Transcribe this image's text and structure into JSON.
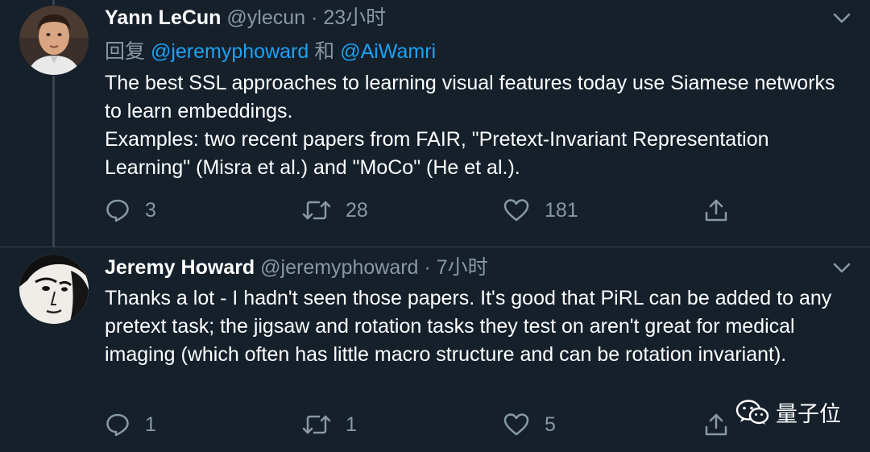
{
  "tweets": [
    {
      "display_name": "Yann LeCun",
      "handle": "@ylecun",
      "separator": "·",
      "time": "23小时",
      "reply_prefix": "回复",
      "reply_mentions": [
        "@jeremyphoward",
        "@AiWamri"
      ],
      "reply_conjunction": "和",
      "text_lines": [
        "The best SSL approaches to learning visual features today use Siamese networks to learn embeddings.",
        "Examples: two recent papers from FAIR, \"Pretext-Invariant Representation Learning\" (Misra et al.) and \"MoCo\" (He et al.)."
      ],
      "actions": {
        "replies": "3",
        "retweets": "28",
        "likes": "181"
      }
    },
    {
      "display_name": "Jeremy Howard",
      "handle": "@jeremyphoward",
      "separator": "·",
      "time": "7小时",
      "text_lines": [
        "Thanks a lot - I hadn't seen those papers. It's good that PiRL can be added to any pretext task; the jigsaw and rotation tasks they test on aren't great for medical imaging (which often has little macro structure and can be rotation invariant)."
      ],
      "actions": {
        "replies": "1",
        "retweets": "1",
        "likes": "5"
      }
    }
  ],
  "watermark": {
    "label": "量子位",
    "icon": "wechat-icon"
  },
  "colors": {
    "background": "#15202b",
    "secondary_text": "#8899a6",
    "link": "#1da1f2",
    "divider": "#38444d"
  }
}
